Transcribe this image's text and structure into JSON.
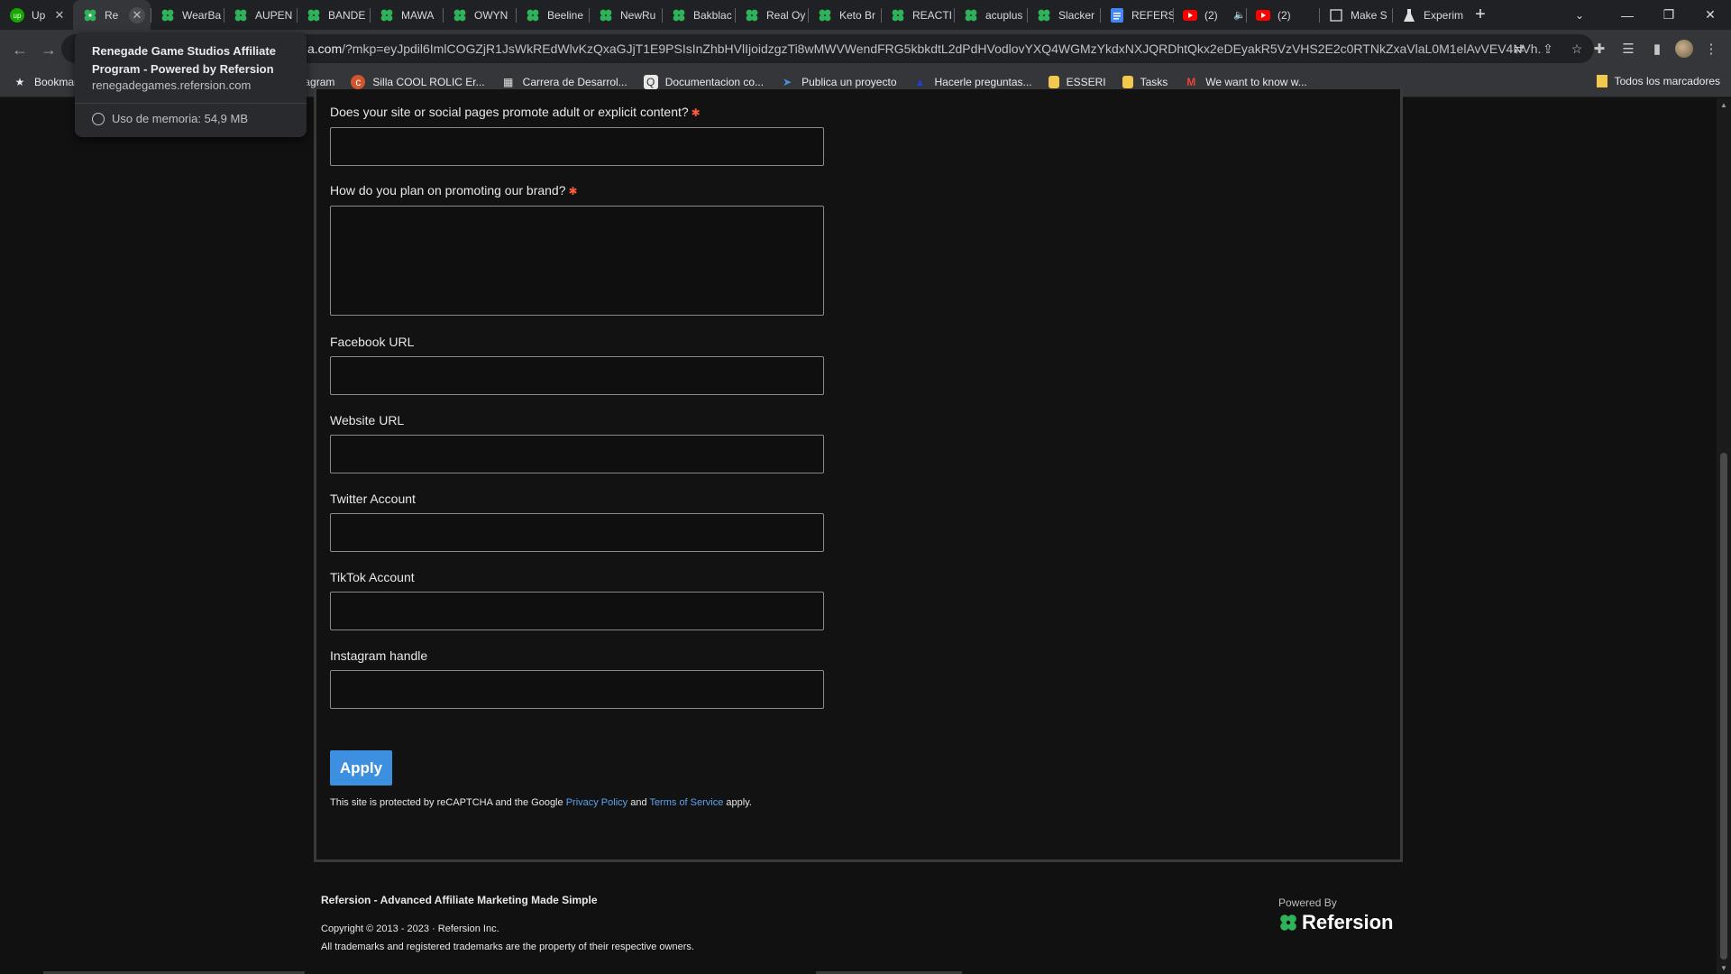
{
  "tabs": [
    {
      "label": "Up",
      "icon": "upwork-icon",
      "active": false,
      "close": "✕"
    },
    {
      "label": "Re",
      "icon": "refersion-leaf-icon",
      "active": true,
      "close": "✕"
    },
    {
      "label": "WearBa",
      "icon": "refersion-leaf-icon"
    },
    {
      "label": "AUPEN",
      "icon": "refersion-leaf-icon"
    },
    {
      "label": "BANDE",
      "icon": "refersion-leaf-icon"
    },
    {
      "label": "MAWA",
      "icon": "refersion-leaf-icon"
    },
    {
      "label": "OWYN",
      "icon": "refersion-leaf-icon"
    },
    {
      "label": "Beeline",
      "icon": "refersion-leaf-icon"
    },
    {
      "label": "NewRu",
      "icon": "refersion-leaf-icon"
    },
    {
      "label": "Bakblac",
      "icon": "refersion-leaf-icon"
    },
    {
      "label": "Real Oy",
      "icon": "refersion-leaf-icon"
    },
    {
      "label": "Keto Br",
      "icon": "refersion-leaf-icon"
    },
    {
      "label": "REACTI",
      "icon": "refersion-leaf-icon"
    },
    {
      "label": "acuplus",
      "icon": "refersion-leaf-icon"
    },
    {
      "label": "Slacker",
      "icon": "refersion-leaf-icon"
    },
    {
      "label": "REFERS",
      "icon": "docs-icon"
    },
    {
      "label": "(2)",
      "icon": "youtube-icon",
      "speaker": "🔈"
    },
    {
      "label": "(2)",
      "icon": "youtube-icon"
    },
    {
      "label": "Make S",
      "icon": "page-icon"
    },
    {
      "label": "Experim",
      "icon": "flask-icon"
    }
  ],
  "new_tab_label": "+",
  "window_controls": {
    "tab_search": "⌄",
    "minimize": "—",
    "restore": "❐",
    "close": "✕"
  },
  "url": {
    "host": "a.com",
    "path": "/?mkp=eyJpdil6ImlCOGZjR1JsWkREdWlvKzQxaGJjT1E9PSIsInZhbHVlIjoidzgzTi8wMWVWendFRG5kbkdtL2dPdHVodlovYXQ4WGMzYkdxNXJQRDhtQkx2eDEyakR5VzVHS2E2c0RTNkZxaVlaL0M1elAvVEV4NVh..."
  },
  "hover_card": {
    "title": "Renegade Game Studios Affiliate Program - Powered by Refersion",
    "domain": "renegadegames.refersion.com",
    "memory": "Uso de memoria: 54,9 MB"
  },
  "bookmarks": [
    {
      "label": "Bookmar",
      "icon": "star-icon"
    },
    {
      "label": "Instagram",
      "icon": "instagram-icon"
    },
    {
      "label": "Silla COOL ROLIC Er...",
      "icon": "circle-logo-icon"
    },
    {
      "label": "Carrera de Desarrol...",
      "icon": "platzi-icon"
    },
    {
      "label": "Documentacion co...",
      "icon": "search-doc-icon"
    },
    {
      "label": "Publica un proyecto",
      "icon": "arrow-logo-icon"
    },
    {
      "label": "Hacerle preguntas...",
      "icon": "flag-icon"
    },
    {
      "label": "ESSERI",
      "icon": "folder-icon"
    },
    {
      "label": "Tasks",
      "icon": "folder-icon"
    },
    {
      "label": "We want to know w...",
      "icon": "gmail-icon"
    }
  ],
  "bookmarks_all": "Todos los marcadores",
  "form": {
    "q_adult": "Does your site or social pages promote adult or explicit content?",
    "q_promote": "How do you plan on promoting our brand?",
    "required_mark": "✱",
    "facebook": "Facebook URL",
    "website": "Website URL",
    "twitter": "Twitter Account",
    "tiktok": "TikTok Account",
    "instagram": "Instagram handle",
    "apply": "Apply",
    "recaptcha_pre": "This site is protected by reCAPTCHA and the Google ",
    "privacy": "Privacy Policy",
    "and": " and ",
    "terms": "Terms of Service",
    "apply_suffix": " apply."
  },
  "footer": {
    "brand": "Refersion - Advanced Affiliate Marketing Made Simple",
    "copyright": "Copyright © 2013 - 2023 · Refersion Inc.",
    "trademarks": "All trademarks and registered trademarks are the property of their respective owners.",
    "powered_by": "Powered By",
    "logo_text": "Refersion"
  },
  "colors": {
    "accent": "#3d8fe0",
    "required": "#ff5a3c",
    "link": "#5aa3f0",
    "leaf_green": "#2fb35a"
  }
}
